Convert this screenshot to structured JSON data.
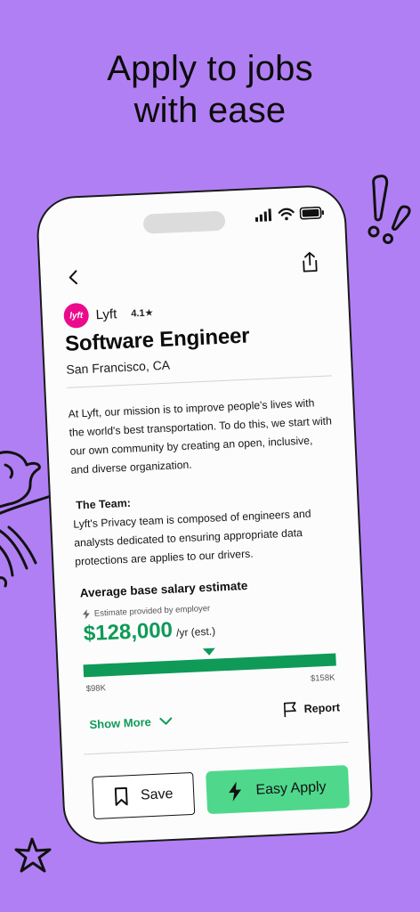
{
  "promo": {
    "headline_line1": "Apply to jobs",
    "headline_line2": "with ease"
  },
  "job": {
    "company": "Lyft",
    "logo_text": "lyft",
    "rating": "4.1★",
    "title": "Software Engineer",
    "location": "San Francisco, CA",
    "description": "At Lyft, our mission is to improve people's lives with the world's best transportation. To do this, we start with our own community by creating an open, inclusive, and diverse organization.",
    "team_heading": "The Team:",
    "team_text": "Lyft's Privacy team is composed of engineers and analysts dedicated to ensuring appropriate data protections are applies to our drivers."
  },
  "salary": {
    "heading": "Average base salary estimate",
    "note": "Estimate provided by employer",
    "amount": "$128,000",
    "unit": "/yr (est.)",
    "range_min": "$98K",
    "range_max": "$158K",
    "estimate_position_fraction": 0.5
  },
  "actions": {
    "show_more": "Show More",
    "report": "Report",
    "save": "Save",
    "easy_apply": "Easy Apply"
  },
  "colors": {
    "background": "#b17ff4",
    "brand_green": "#0f9a58",
    "apply_green": "#4fd88c",
    "lyft_pink": "#ea0b8c"
  },
  "icons": [
    "back-icon",
    "share-icon",
    "signal-icon",
    "wifi-icon",
    "battery-icon",
    "lightning-icon",
    "chevron-down-icon",
    "flag-icon",
    "bookmark-icon"
  ]
}
